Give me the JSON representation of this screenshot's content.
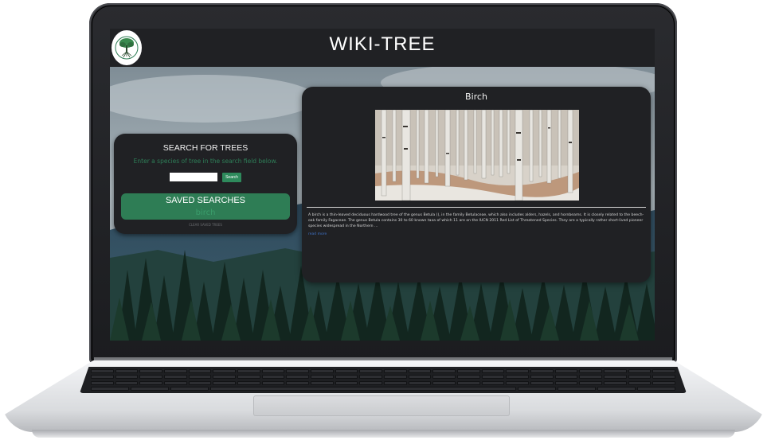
{
  "site": {
    "title": "WIKI-TREE",
    "logo_icon": "tree-logo-icon"
  },
  "search": {
    "title": "SEARCH FOR TREES",
    "hint": "Enter a species of tree in the search field below.",
    "input_value": "",
    "button_label": "Search"
  },
  "saved": {
    "title": "SAVED SEARCHES",
    "items": [
      "birch"
    ],
    "clear_label": "CLEAR SAVED TREES"
  },
  "result": {
    "title": "Birch",
    "description": "A birch is a thin-leaved deciduous hardwood tree of the genus Betula (), in the family Betulaceae, which also includes alders, hazels, and hornbeams. It is closely related to the beech-oak family Fagaceae. The genus Betula contains 30 to 60 known taxa of which 11 are on the IUCN 2011 Red List of Threatened Species. They are a typically rather short-lived pioneer species widespread in the Northern ...",
    "read_more": "read more"
  },
  "colors": {
    "header_bg": "#202124",
    "panel_bg": "#202124",
    "accent_green": "#2e7d55",
    "hint_green": "#2e7f58",
    "link_blue": "#3f73c9"
  }
}
